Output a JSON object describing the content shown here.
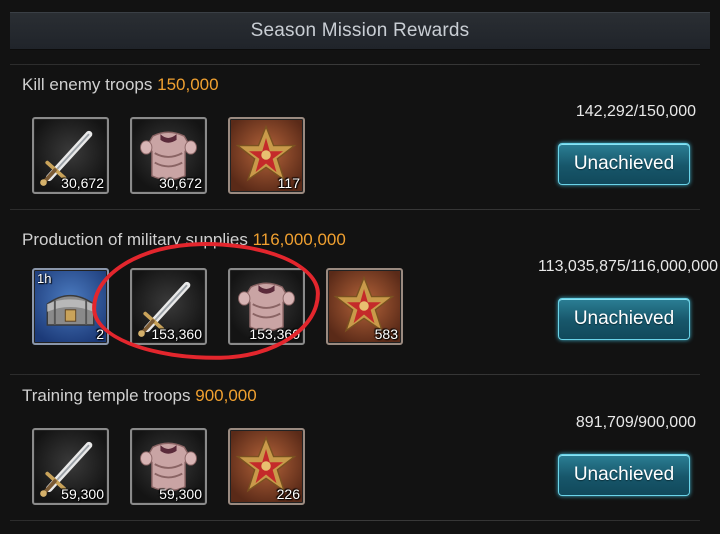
{
  "header": {
    "title": "Season Mission Rewards"
  },
  "colors": {
    "target": "#f0a030",
    "button": "#1f6f84",
    "highlight": "#e3262d"
  },
  "missions": [
    {
      "label": "Kill enemy troops",
      "target": "150,000",
      "progress": "142,292/150,000",
      "status": "Unachieved",
      "rewards": [
        {
          "icon": "sword-icon",
          "count": "30,672"
        },
        {
          "icon": "armor-icon",
          "count": "30,672"
        },
        {
          "icon": "medal-icon",
          "count": "117"
        }
      ]
    },
    {
      "label": "Production of military supplies",
      "target": "116,000,000",
      "progress": "113,035,875/116,000,000",
      "status": "Unachieved",
      "rewards": [
        {
          "icon": "speedup-chest-icon",
          "timer": "1h",
          "count": "2"
        },
        {
          "icon": "sword-icon",
          "count": "153,360"
        },
        {
          "icon": "armor-icon",
          "count": "153,360"
        },
        {
          "icon": "medal-icon",
          "count": "583"
        }
      ]
    },
    {
      "label": "Training temple troops",
      "target": "900,000",
      "progress": "891,709/900,000",
      "status": "Unachieved",
      "rewards": [
        {
          "icon": "sword-icon",
          "count": "59,300"
        },
        {
          "icon": "armor-icon",
          "count": "59,300"
        },
        {
          "icon": "medal-icon",
          "count": "226"
        }
      ]
    }
  ]
}
